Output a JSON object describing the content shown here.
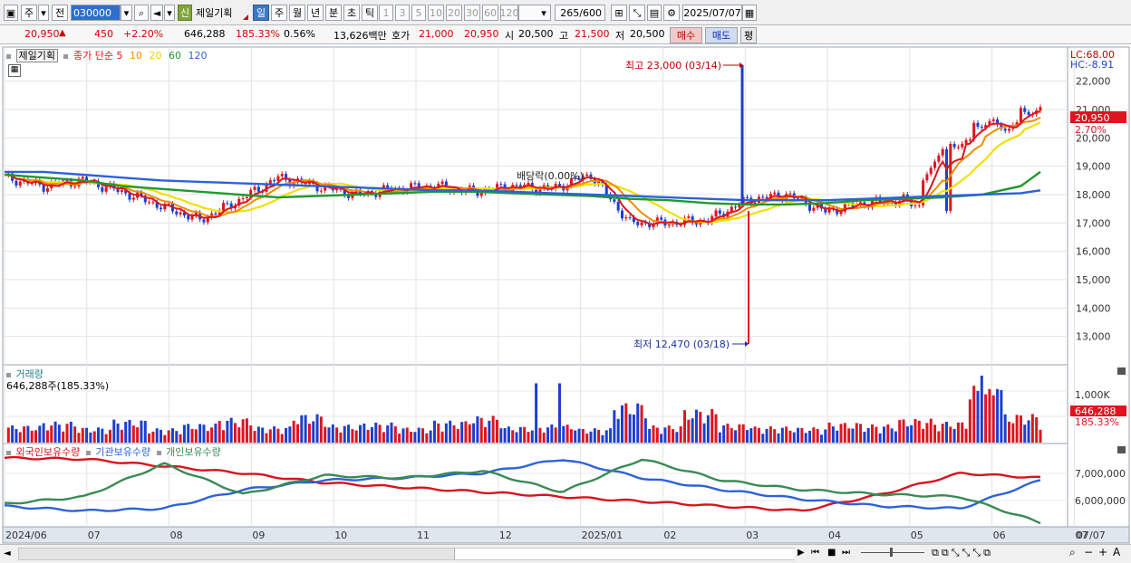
{
  "toolbar": {
    "type_label": "주",
    "prev_label": "전",
    "stock_code": "030000",
    "badge_new": "신",
    "stock_name": "제일기획",
    "periods": [
      "일",
      "주",
      "월",
      "년",
      "분",
      "초",
      "틱"
    ],
    "active_period": "일",
    "intervals": [
      "1",
      "3",
      "5",
      "10",
      "20",
      "30",
      "60",
      "120"
    ],
    "count_value": "265",
    "count_total": "/600",
    "date": "2025/07/07"
  },
  "quote": {
    "price": "20,950",
    "change": "450",
    "change_pct": "+2.20%",
    "volume": "646,288",
    "vol_ratio": "185.33%",
    "turnover": "0.56%",
    "amount": "13,626백만",
    "hoga_label": "호가",
    "ask": "21,000",
    "bid": "20,950",
    "open_label": "시",
    "open": "20,500",
    "high_label": "고",
    "high": "21,500",
    "low_label": "저",
    "low": "20,500",
    "buy_label": "매수",
    "sell_label": "매도",
    "avg_label": "평"
  },
  "price_panel": {
    "name": "제일기획",
    "ma_label": "종가 단순",
    "ma_periods": [
      "5",
      "10",
      "20",
      "60",
      "120"
    ],
    "lc": "LC:68.00",
    "hc": "HC:-8.91",
    "current": "20,950",
    "current_pct": "2.70%",
    "high_annotation": "최고 23,000 (03/14)",
    "low_annotation": "최저 12,470 (03/18)",
    "dividend_annotation": "배당락(0.00%)"
  },
  "volume_panel": {
    "title": "거래량",
    "value": "646,288주(185.33%)",
    "axis_label": "1,000K",
    "current": "646,288",
    "current_pct": "185.33%"
  },
  "holdings_panel": {
    "legend": [
      "외국인보유수량",
      "기관보유수량",
      "개인보유수량"
    ],
    "axis_labels": [
      "7,000,000",
      "6,000,000"
    ]
  },
  "x_axis": [
    "2024/06",
    "07",
    "08",
    "09",
    "10",
    "11",
    "12",
    "2025/01",
    "02",
    "03",
    "04",
    "05",
    "06",
    "07"
  ],
  "x_axis_right": "07/07",
  "colors": {
    "ma5": "#e0141e",
    "ma10": "#f08c00",
    "ma20": "#f0e000",
    "ma60": "#1f9a2e",
    "ma120": "#2d62d8",
    "up": "#e0141e",
    "down": "#1c3fd0",
    "foreign": "#d8141e",
    "inst": "#2d62d8",
    "indiv": "#3a8a55"
  },
  "chart_data": [
    {
      "type": "line",
      "name": "price",
      "y_ticks": [
        22000,
        21000,
        20000,
        19000,
        18000,
        17000,
        16000,
        15000,
        14000,
        13000
      ],
      "ylim": [
        12000,
        23200
      ],
      "x": [
        0,
        10,
        20,
        30,
        40,
        50,
        60,
        70,
        80,
        90,
        100,
        110,
        120,
        130,
        140,
        150,
        160,
        170,
        180,
        190,
        200,
        210,
        220,
        230,
        240,
        250,
        260,
        265
      ],
      "close": [
        18600,
        18300,
        18500,
        18100,
        17600,
        17100,
        17800,
        18600,
        18300,
        18000,
        18200,
        18300,
        18100,
        18300,
        18200,
        18700,
        17000,
        17000,
        17100,
        17800,
        18000,
        17400,
        17700,
        17800,
        17300,
        18300,
        18400,
        18300
      ],
      "close_tail": [
        19800,
        20500,
        20400,
        20950
      ],
      "ma60": [
        18700,
        18600,
        18500,
        18300,
        18200,
        18100,
        18000,
        17900,
        17950,
        18000,
        18050,
        18100,
        18100,
        18050,
        18000,
        17950,
        17850,
        17800,
        17700,
        17650,
        17650,
        17700,
        17800,
        17850,
        17900,
        18000,
        18300,
        18800
      ],
      "ma120": [
        18800,
        18800,
        18700,
        18600,
        18500,
        18450,
        18400,
        18350,
        18300,
        18250,
        18200,
        18150,
        18150,
        18100,
        18050,
        18000,
        17950,
        17900,
        17850,
        17800,
        17800,
        17800,
        17850,
        17900,
        17950,
        18000,
        18050,
        18150
      ]
    },
    {
      "type": "bar",
      "name": "volume",
      "values": [
        180,
        220,
        160,
        240,
        150,
        200,
        260,
        170,
        300,
        190,
        210,
        160,
        230,
        280,
        170,
        190,
        150,
        420,
        180,
        350,
        200,
        170,
        160,
        210,
        190,
        250,
        220,
        600,
        300,
        260
      ]
    },
    {
      "type": "line",
      "name": "holdings",
      "series": [
        {
          "name": "외국인보유수량",
          "values": [
            7750000,
            7700000,
            7400000,
            7100000,
            6700000,
            6500000,
            6300000,
            6100000,
            5900000,
            5700000,
            5500000,
            6200000,
            7100000,
            6900000
          ]
        },
        {
          "name": "기관보유수량",
          "values": [
            5700000,
            5500000,
            5600000,
            6400000,
            6800000,
            6900000,
            7100000,
            7700000,
            6900000,
            6400000,
            6000000,
            5700000,
            5600000,
            6800000
          ]
        },
        {
          "name": "개인보유수량",
          "values": [
            5800000,
            6100000,
            7500000,
            6200000,
            7000000,
            6900000,
            7200000,
            6300000,
            7700000,
            6800000,
            6400000,
            6200000,
            6100000,
            5000000
          ]
        }
      ]
    }
  ]
}
